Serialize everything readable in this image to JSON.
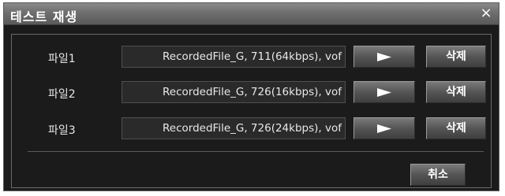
{
  "dialog": {
    "title": "테스트 재생",
    "close_symbol": "×"
  },
  "files": [
    {
      "label": "파일1",
      "filename": "RecordedFile_G, 711(64kbps), vof",
      "delete_label": "삭제"
    },
    {
      "label": "파일2",
      "filename": "RecordedFile_G, 726(16kbps), vof",
      "delete_label": "삭제"
    },
    {
      "label": "파일3",
      "filename": "RecordedFile_G, 726(24kbps), vof",
      "delete_label": "삭제"
    }
  ],
  "footer": {
    "cancel_label": "취소"
  },
  "icons": {
    "play": "play-icon",
    "close": "close-icon"
  },
  "colors": {
    "background": "#1b1b1b",
    "titlebar": "#6e6e6e",
    "text": "#e6e6e6"
  }
}
